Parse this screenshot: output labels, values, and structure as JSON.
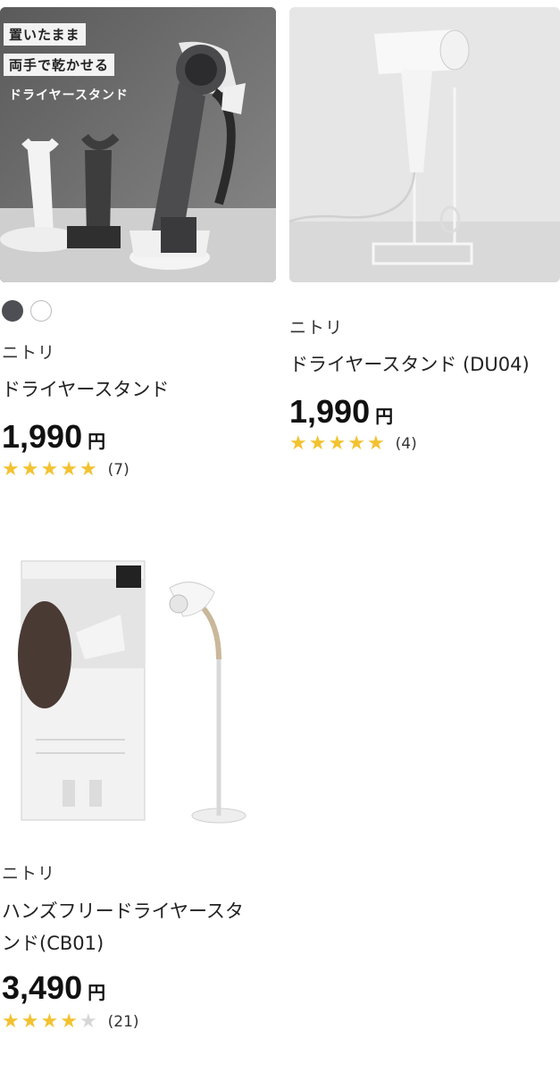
{
  "products": [
    {
      "brand": "ニトリ",
      "name": "ドライヤースタンド",
      "price": "1,990",
      "currency": "円",
      "rating": 5,
      "reviews": "(7)",
      "colors": [
        "#4d4f55",
        "#ffffff"
      ],
      "image_text": [
        "置いたまま",
        "両手で乾かせる",
        "ドライヤースタンド"
      ]
    },
    {
      "brand": "ニトリ",
      "name": "ドライヤースタンド (DU04)",
      "price": "1,990",
      "currency": "円",
      "rating": 5,
      "reviews": "(4)"
    },
    {
      "brand": "ニトリ",
      "name_line1": "ハンズフリードライヤースタ",
      "name_line2": "ンド(CB01)",
      "price": "3,490",
      "currency": "円",
      "rating": 4,
      "reviews": "(21)"
    }
  ],
  "colors": {
    "star": "#f2c230",
    "star_off": "#d7d7d7"
  }
}
